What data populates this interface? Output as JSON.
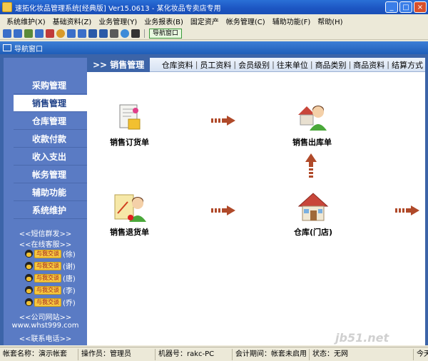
{
  "window": {
    "title": "速拓化妆品管理系统[经典版] Ver15.0613  -  某化妆品专卖店专用",
    "minimize": "_",
    "maximize": "□",
    "close": "×"
  },
  "menu": [
    "系统维护(X)",
    "基础资料(Z)",
    "业务管理(Y)",
    "业务报表(B)",
    "固定资产",
    "帐务管理(C)",
    "辅助功能(F)",
    "帮助(H)"
  ],
  "toolbar": {
    "nav_button": "导航窗口",
    "icon_colors": [
      "#3b6fc9",
      "#3b6fc9",
      "#5a8a3a",
      "#3b6fc9",
      "#c03a3a",
      "#d89a2a",
      "#3b6fc9",
      "#3b6fc9",
      "#2a5aa8",
      "#2a5aa8",
      "#5a5a5a",
      "#3b8ad8",
      "#333333"
    ]
  },
  "nav_window": {
    "title": "导航窗口"
  },
  "sidebar": {
    "items": [
      {
        "label": "采购管理",
        "active": false
      },
      {
        "label": "销售管理",
        "active": true
      },
      {
        "label": "仓库管理",
        "active": false
      },
      {
        "label": "收款付款",
        "active": false
      },
      {
        "label": "收入支出",
        "active": false
      },
      {
        "label": "帐务管理",
        "active": false
      },
      {
        "label": "辅助功能",
        "active": false
      },
      {
        "label": "系统维护",
        "active": false
      }
    ],
    "sms": "<<短信群发>>",
    "online_service": "<<在线客服>>",
    "qq_badge": "与我交谈",
    "qq_names": [
      "(徐)",
      "(谢)",
      "(唐)",
      "(李)",
      "(乔)"
    ],
    "company_site": "<<公司网站>>",
    "site_url": "www.whst999.com",
    "contact": "<<联系电话>>"
  },
  "main": {
    "current_tab": ">> 销售管理",
    "tabs": [
      "仓库资料",
      "员工资料",
      "会员级别",
      "往来单位",
      "商品类别",
      "商品资料",
      "结算方式"
    ],
    "nodes": {
      "sales_order": "销售订货单",
      "sales_out": "销售出库单",
      "sales_return": "销售退货单",
      "warehouse": "仓库(门店)"
    }
  },
  "status": {
    "account": "帐套名称：演示帐套",
    "operator": "操作员：管理员",
    "machine": "机器号：rakc-PC",
    "period": "会计期间：帐套未启用",
    "state": "状态：无网",
    "today": "今天"
  },
  "watermark": "jb51.net",
  "colors": {
    "frame": "#3c64a8",
    "sidebar": "#5a7bc4",
    "arrow": "#b04a2a"
  }
}
